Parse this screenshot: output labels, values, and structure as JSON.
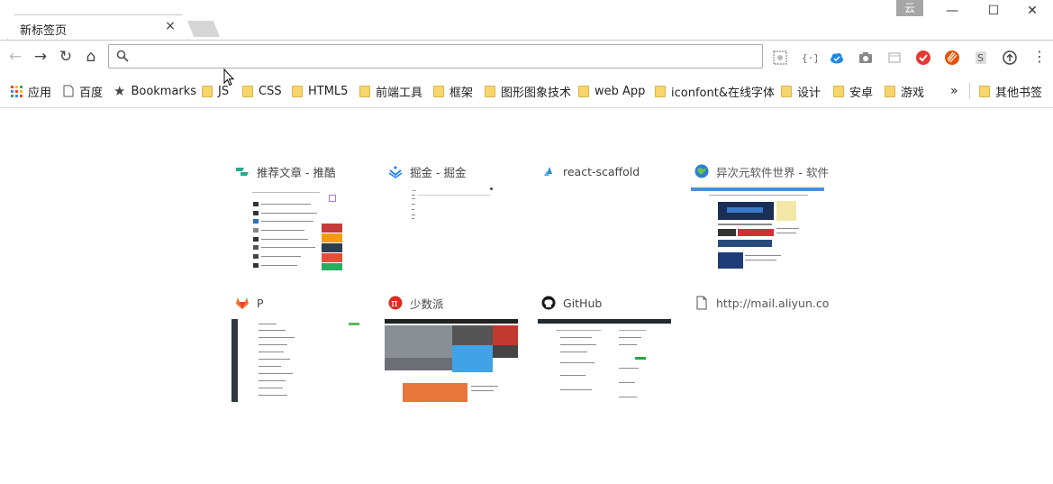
{
  "tab": {
    "title": "新标签页",
    "close": "×"
  },
  "window": {
    "profile": "云",
    "minimize": "—",
    "maximize": "☐",
    "close": "✕"
  },
  "toolbar": {
    "back": "←",
    "forward": "→",
    "reload": "↻",
    "home": "⌂",
    "address_value": "",
    "address_placeholder": ""
  },
  "extensions": [
    "extension-puzzle-icon",
    "json-formatter-icon",
    "cloud-icon",
    "camera-icon",
    "window-icon",
    "todoist-icon",
    "stylish-icon",
    "s-icon",
    "upload-icon"
  ],
  "menu": "⋮",
  "bookmarks": {
    "items": [
      {
        "label": "应用",
        "icon": "apps-grid-icon"
      },
      {
        "label": "百度",
        "icon": "page-icon"
      },
      {
        "label": "Bookmarks",
        "icon": "star-icon"
      },
      {
        "label": "JS",
        "icon": "folder-icon"
      },
      {
        "label": "CSS",
        "icon": "folder-icon"
      },
      {
        "label": "HTML5",
        "icon": "folder-icon"
      },
      {
        "label": "前端工具",
        "icon": "folder-icon"
      },
      {
        "label": "框架",
        "icon": "folder-icon"
      },
      {
        "label": "图形图象技术",
        "icon": "folder-icon"
      },
      {
        "label": "web App",
        "icon": "folder-icon"
      },
      {
        "label": "iconfont&在线字体",
        "icon": "folder-icon"
      },
      {
        "label": "设计",
        "icon": "folder-icon"
      },
      {
        "label": "安卓",
        "icon": "folder-icon"
      },
      {
        "label": "游戏",
        "icon": "folder-icon"
      }
    ],
    "overflow": "»",
    "other": "其他书签"
  },
  "most_visited": [
    {
      "title": "推荐文章 - 推酷",
      "icon": "tuicool-icon"
    },
    {
      "title": "掘金 - 掘金",
      "icon": "juejin-icon"
    },
    {
      "title": "react-scaffold",
      "icon": "react-icon"
    },
    {
      "title": "异次元软件世界 - 软件",
      "icon": "globe-icon"
    },
    {
      "title": "P",
      "icon": "gitlab-icon"
    },
    {
      "title": "少数派",
      "icon": "sspai-icon"
    },
    {
      "title": "GitHub",
      "icon": "github-icon"
    },
    {
      "title": "http://mail.aliyun.com",
      "icon": "page-icon"
    }
  ],
  "colors": {
    "accent_blue": "#1a73e8",
    "folder_yellow": "#f7d56a",
    "border": "#a9a9a9"
  }
}
